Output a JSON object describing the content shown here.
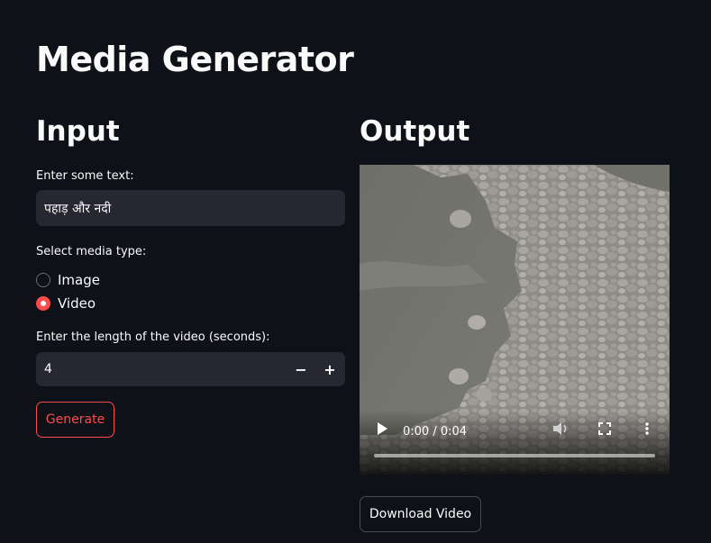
{
  "page": {
    "title": "Media Generator"
  },
  "input": {
    "section_title": "Input",
    "text_label": "Enter some text:",
    "text_value": "पहाड़ और नदी",
    "media_type_label": "Select media type:",
    "media_options": [
      {
        "label": "Image",
        "selected": false
      },
      {
        "label": "Video",
        "selected": true
      }
    ],
    "length_label": "Enter the length of the video (seconds):",
    "length_value": "4",
    "decrement_symbol": "−",
    "increment_symbol": "+",
    "generate_label": "Generate"
  },
  "output": {
    "section_title": "Output",
    "video": {
      "time_display": "0:00 / 0:04",
      "progress": 0.0,
      "icons": [
        "play-icon",
        "volume-icon",
        "fullscreen-icon",
        "more-options-icon"
      ]
    },
    "download_label": "Download Video"
  },
  "colors": {
    "background": "#0e1117",
    "input_bg": "#262730",
    "accent": "#ff4b4b",
    "text": "#fafafa"
  }
}
